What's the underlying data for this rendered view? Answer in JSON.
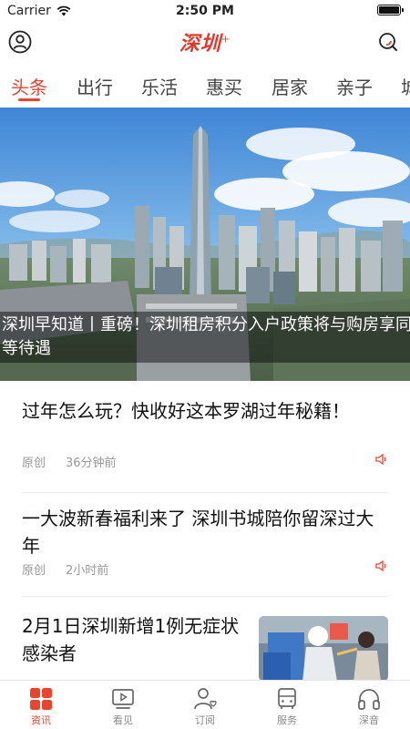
{
  "status_bar": {
    "carrier": "Carrier",
    "time": "2:50 PM",
    "icons": [
      "wifi-icon",
      "battery-icon"
    ]
  },
  "header": {
    "logo_text": "深圳",
    "logo_plus": "+",
    "icons": [
      "profile-icon",
      "search-icon"
    ]
  },
  "tabs": [
    {
      "label": "头条",
      "active": true
    },
    {
      "label": "出行",
      "active": false
    },
    {
      "label": "乐活",
      "active": false
    },
    {
      "label": "惠买",
      "active": false
    },
    {
      "label": "居家",
      "active": false
    },
    {
      "label": "亲子",
      "active": false
    },
    {
      "label": "城",
      "active": false
    }
  ],
  "hero": {
    "caption": "深圳早知道丨重磅！深圳租房积分入户政策将与购房享同等待遇"
  },
  "articles": [
    {
      "title": "过年怎么玩？快收好这本罗湖过年秘籍！",
      "source": "原创",
      "time": "36分钟前",
      "has_audio": true
    },
    {
      "title": "一大波新春福利来了 深圳书城陪你留深过大年",
      "source": "原创",
      "time": "2小时前",
      "has_audio": true
    },
    {
      "title": "2月1日深圳新增1例无症状感染者",
      "has_thumbnail": true
    }
  ],
  "bottom_nav": [
    {
      "label": "资讯",
      "icon": "news-grid-icon",
      "active": true
    },
    {
      "label": "看见",
      "icon": "video-play-icon",
      "active": false
    },
    {
      "label": "订阅",
      "icon": "subscribe-user-icon",
      "active": false
    },
    {
      "label": "服务",
      "icon": "bus-icon",
      "active": false
    },
    {
      "label": "深音",
      "icon": "headphones-icon",
      "active": false
    }
  ],
  "colors": {
    "accent": "#e8442e",
    "text": "#111111",
    "meta": "#999999"
  }
}
